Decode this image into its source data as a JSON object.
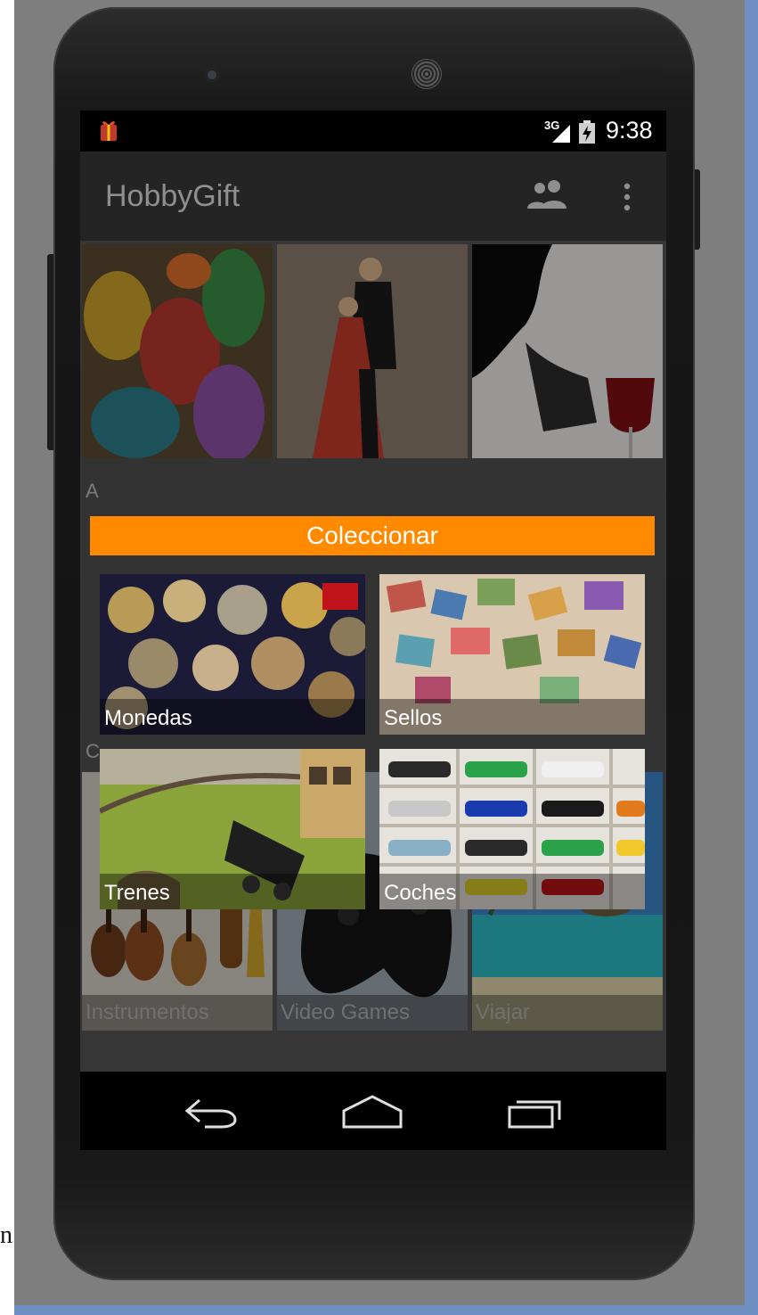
{
  "status_bar": {
    "network_type": "3G",
    "time": "9:38",
    "icons": [
      "gift-notification-icon",
      "signal-icon",
      "battery-charging-icon"
    ]
  },
  "action_bar": {
    "title": "HobbyGift",
    "actions": [
      "people-icon",
      "overflow-menu-icon"
    ]
  },
  "background_grid": {
    "row1": [
      "",
      "",
      ""
    ],
    "row2_left_letter": "A",
    "row3_left_letter": "C",
    "row4": [
      "Instrumentos",
      "Video Games",
      "Viajar"
    ]
  },
  "dialog": {
    "title": "Coleccionar",
    "title_color": "#ff8a00",
    "items": [
      {
        "label": "Monedas"
      },
      {
        "label": "Sellos"
      },
      {
        "label": "Trenes"
      },
      {
        "label": "Coches"
      }
    ]
  },
  "nav_bar": {
    "buttons": [
      "back-icon",
      "home-icon",
      "recent-apps-icon"
    ]
  }
}
